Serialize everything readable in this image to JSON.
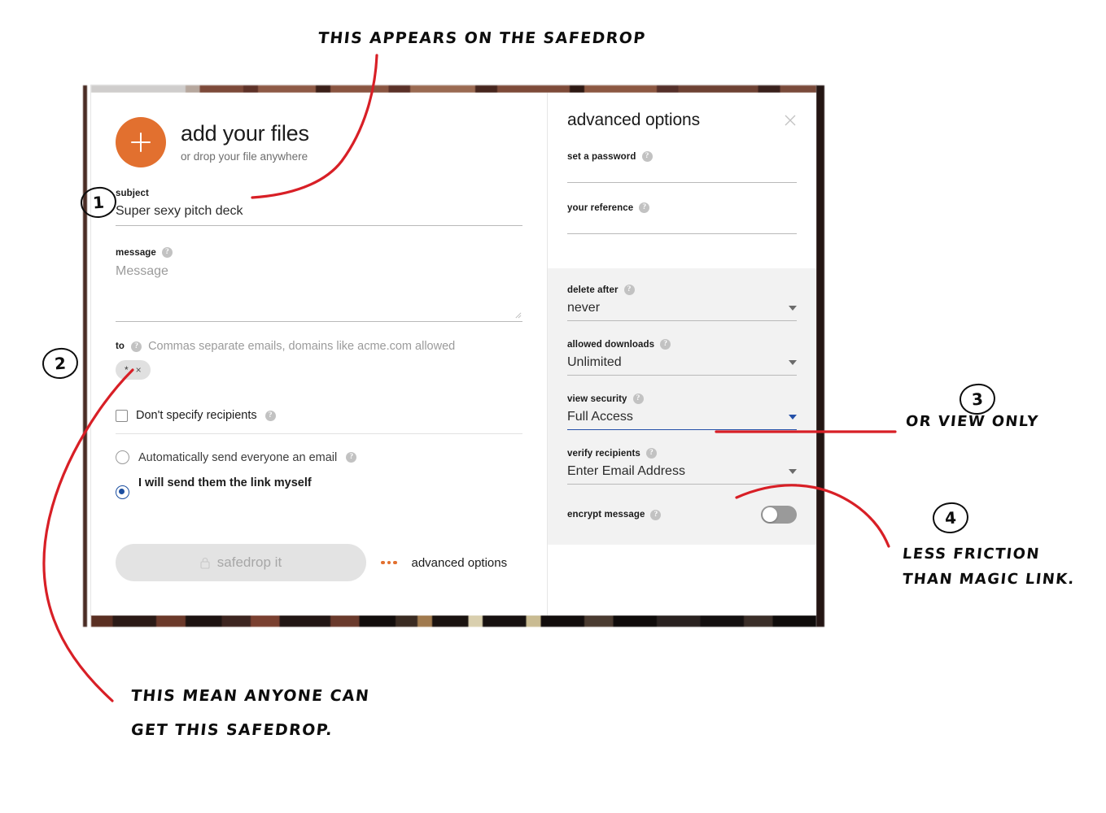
{
  "app": {
    "left": {
      "hero_title": "add your files",
      "hero_sub": "or drop your file anywhere",
      "subject_label": "subject",
      "subject_value": "Super sexy pitch deck",
      "message_label": "message",
      "message_placeholder": "Message",
      "to_label": "to",
      "to_placeholder": "Commas separate emails, domains like acme.com allowed",
      "recipient_chip": "*",
      "chip_remove": "×",
      "dont_specify_label": "Don't specify recipients",
      "radio_auto_label": "Automatically send everyone an email",
      "radio_self_label": "I will send them the link myself",
      "submit_label": "safedrop it",
      "advanced_link": "advanced options",
      "help_glyph": "?"
    },
    "right": {
      "title": "advanced options",
      "close_glyph": "×",
      "password_label": "set a password",
      "password_value": "",
      "reference_label": "your reference",
      "reference_value": "",
      "delete_after_label": "delete after",
      "delete_after_value": "never",
      "allowed_downloads_label": "allowed downloads",
      "allowed_downloads_value": "Unlimited",
      "view_security_label": "view security",
      "view_security_value": "Full Access",
      "verify_recipients_label": "verify recipients",
      "verify_recipients_value": "Enter Email Address",
      "encrypt_label": "encrypt message",
      "encrypt_state": "off"
    }
  },
  "annotations": {
    "note_top": "THIS APPEARS ON THE SAFEDROP",
    "marker_1": "1",
    "marker_2": "2",
    "marker_3": "3",
    "marker_4": "4",
    "note_bottom_line1": "THIS MEAN ANYONE CAN",
    "note_bottom_line2": "GET THIS SAFEDROP.",
    "note_view_security": "OR VIEW ONLY",
    "note_verify_line1": "LESS FRICTION",
    "note_verify_line2": "THAN MAGIC LINK.",
    "ink_color": "#d81f26"
  },
  "colors": {
    "accent": "#e2702f",
    "focus_blue": "#2450a8",
    "panel_grey": "#f2f2f2"
  }
}
